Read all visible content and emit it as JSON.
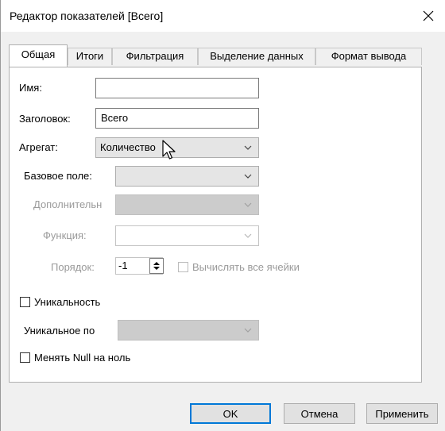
{
  "window": {
    "title": "Редактор показателей [Всего]"
  },
  "tabs": [
    {
      "label": "Общая",
      "active": true
    },
    {
      "label": "Итоги",
      "active": false
    },
    {
      "label": "Фильтрация",
      "active": false
    },
    {
      "label": "Выделение данных",
      "active": false
    },
    {
      "label": "Формат вывода",
      "active": false
    }
  ],
  "form": {
    "name_label": "Имя:",
    "name_value": "",
    "caption_label": "Заголовок:",
    "caption_value": "Всего",
    "aggregate_label": "Агрегат:",
    "aggregate_value": "Количество",
    "base_field_label": "Базовое поле:",
    "base_field_value": "",
    "additional_label": "Дополнительн",
    "additional_value": "",
    "function_label": "Функция:",
    "function_value": "",
    "order_label": "Порядок:",
    "order_value": "-1",
    "calc_all_cells_label": "Вычислять все ячейки",
    "calc_all_cells_checked": false,
    "uniqueness_label": "Уникальность",
    "uniqueness_checked": false,
    "unique_field_label": "Уникальное по",
    "unique_field_value": "",
    "null_to_zero_label": "Менять Null на ноль",
    "null_to_zero_checked": false
  },
  "buttons": {
    "ok": "OK",
    "cancel": "Отмена",
    "apply": "Применить"
  },
  "icons": {
    "close": "close-icon",
    "dropdown": "chevron-down-icon",
    "spinner": "spinner-arrows-icon",
    "cursor": "mouse-pointer-icon"
  },
  "colors": {
    "dialog_bg": "#f0f0f0",
    "panel_bg": "#ffffff",
    "focus_border": "#0078d7",
    "disabled_text": "#9a9a9a",
    "disabled_combo": "#cccccc"
  }
}
